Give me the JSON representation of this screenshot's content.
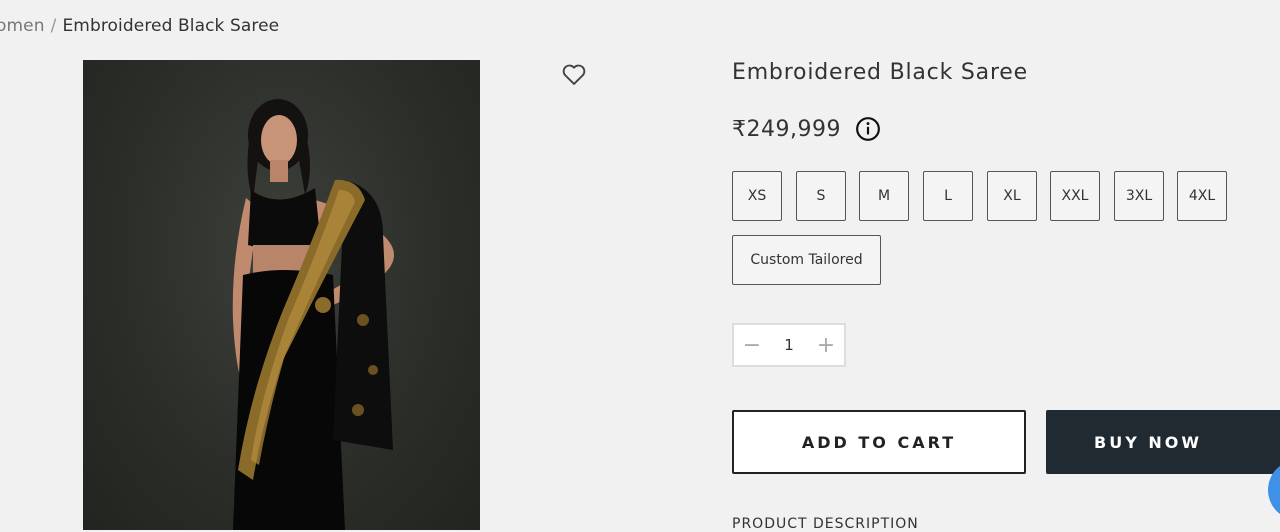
{
  "breadcrumb": {
    "parent": "omen",
    "separator": "/",
    "current": "Embroidered Black Saree"
  },
  "product": {
    "title": "Embroidered Black Saree",
    "price": "₹249,999",
    "image_alt": "Model wearing embroidered black saree"
  },
  "sizes": [
    "XS",
    "S",
    "M",
    "L",
    "XL",
    "XXL",
    "3XL",
    "4XL"
  ],
  "custom_size": "Custom Tailored",
  "quantity": {
    "value": "1",
    "minus": "−",
    "plus": "+"
  },
  "actions": {
    "add_to_cart": "ADD TO CART",
    "buy_now": "BUY NOW"
  },
  "description_heading": "PRODUCT DESCRIPTION",
  "icons": {
    "wishlist": "heart-outline-icon",
    "info": "info-circle-icon",
    "chat": "chat-bubble-icon"
  },
  "colors": {
    "buy_now_bg": "#222a31",
    "chat_bubble": "#3e91e6",
    "page_bg": "#f1f1f1"
  }
}
